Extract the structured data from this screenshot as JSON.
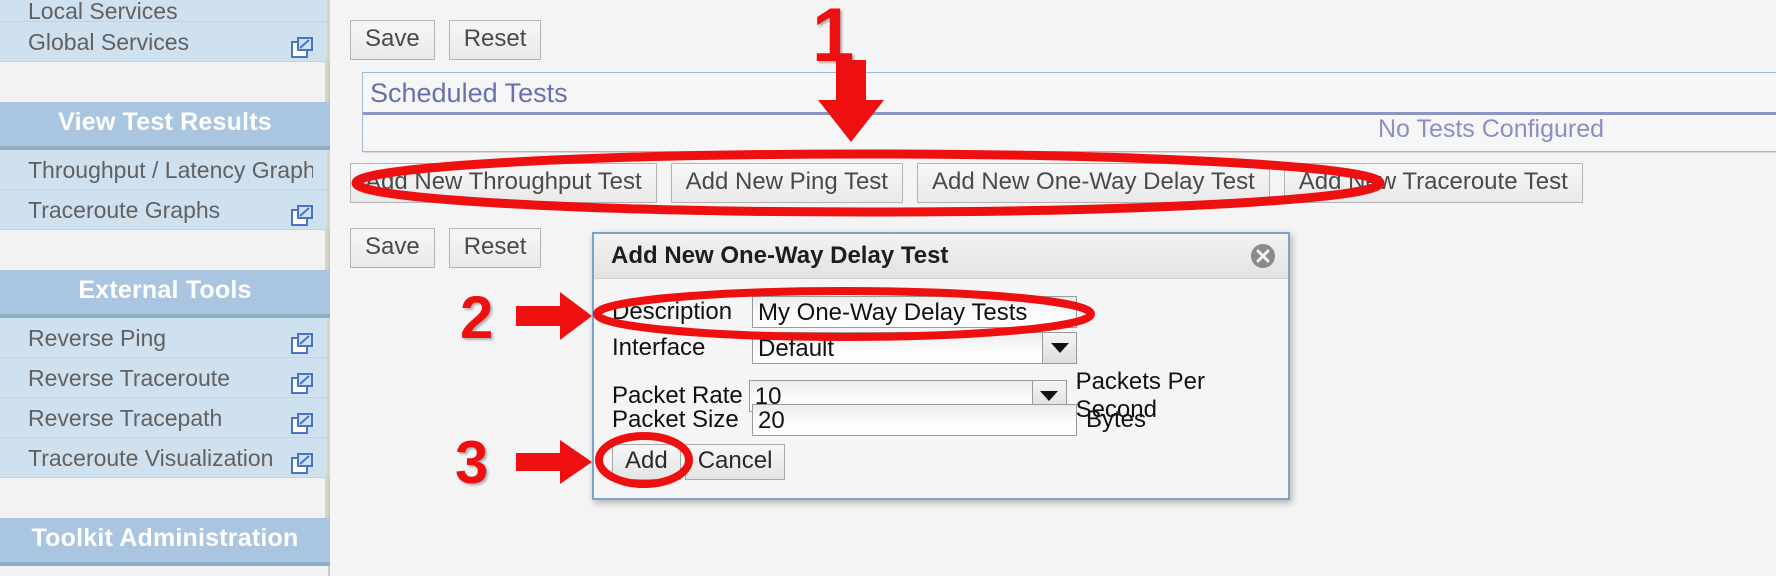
{
  "sidebar": {
    "groups": [
      {
        "header": null,
        "items": [
          {
            "label": "Local Services",
            "external": false,
            "partial_top": true
          },
          {
            "label": "Global Services",
            "external": true
          }
        ]
      },
      {
        "header": "View Test Results",
        "items": [
          {
            "label": "Throughput / Latency Graphs",
            "external": false
          },
          {
            "label": "Traceroute Graphs",
            "external": true
          }
        ]
      },
      {
        "header": "External Tools",
        "items": [
          {
            "label": "Reverse Ping",
            "external": true
          },
          {
            "label": "Reverse Traceroute",
            "external": true
          },
          {
            "label": "Reverse Tracepath",
            "external": true
          },
          {
            "label": "Traceroute Visualization",
            "external": true
          }
        ]
      },
      {
        "header": "Toolkit Administration",
        "items": []
      }
    ]
  },
  "main": {
    "top_buttons": {
      "save_label": "Save",
      "reset_label": "Reset"
    },
    "scheduled_tests": {
      "title": "Scheduled Tests",
      "empty_message": "No Tests Configured"
    },
    "add_test_buttons": [
      "Add New Throughput Test",
      "Add New Ping Test",
      "Add New One-Way Delay Test",
      "Add New Traceroute Test"
    ],
    "bottom_buttons": {
      "save_label": "Save",
      "reset_label": "Reset"
    }
  },
  "dialog": {
    "title": "Add New One-Way Delay Test",
    "close_icon": "close-icon",
    "fields": {
      "description": {
        "label": "Description",
        "value": "My One-Way Delay Tests"
      },
      "interface": {
        "label": "Interface",
        "value": "Default",
        "control": "dropdown"
      },
      "packet_rate": {
        "label": "Packet Rate",
        "value": "10",
        "control": "dropdown",
        "unit": "Packets Per Second"
      },
      "packet_size": {
        "label": "Packet Size",
        "value": "20",
        "control": "text",
        "unit": "Bytes"
      }
    },
    "add_label": "Add",
    "cancel_label": "Cancel"
  },
  "annotations": {
    "color": "#ee1010",
    "markers": [
      {
        "number": "1",
        "target": "add-test-buttons-row"
      },
      {
        "number": "2",
        "target": "description-field"
      },
      {
        "number": "3",
        "target": "add-button"
      }
    ]
  }
}
